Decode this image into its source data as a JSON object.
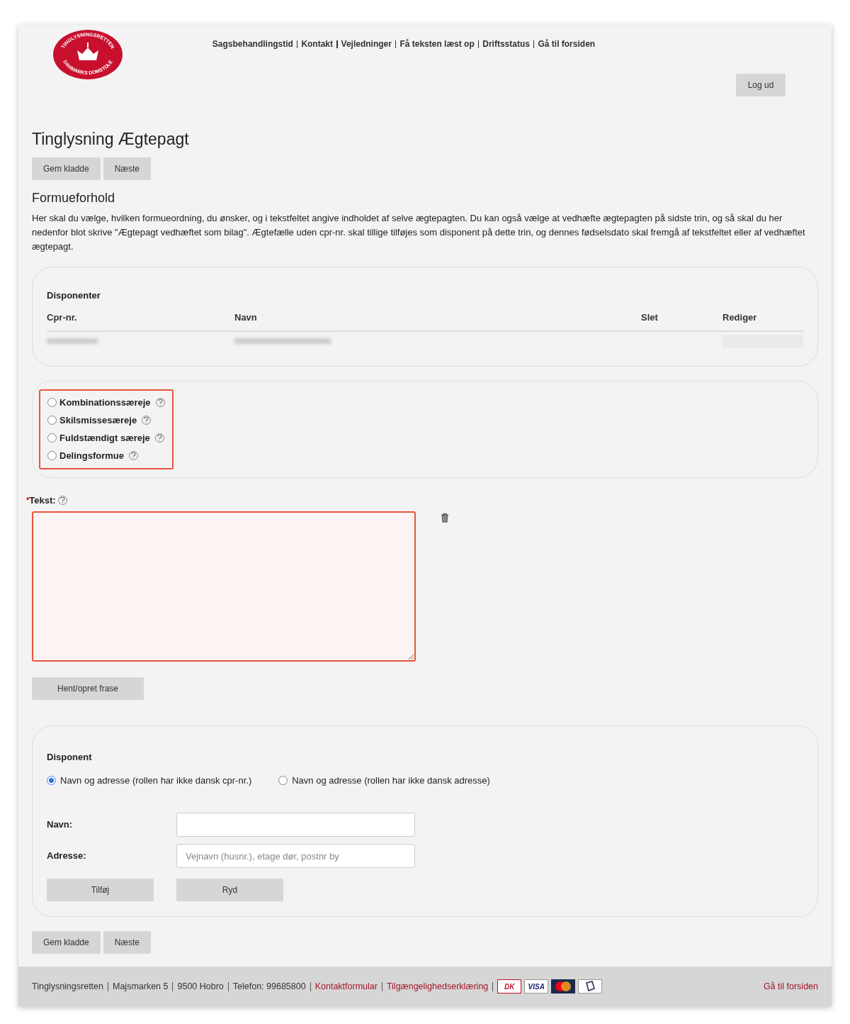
{
  "logo": {
    "top_text": "TINGLYSNINGSRETTEN",
    "bottom_text": "DANMARKS DOMSTOLE"
  },
  "top_links": [
    "Sagsbehandlingstid",
    "Kontakt",
    "Vejledninger",
    "Få teksten læst op",
    "Driftsstatus",
    "Gå til forsiden"
  ],
  "logout_button": "Log ud",
  "title": "Tinglysning Ægtepagt",
  "top_buttons": [
    "Gem kladde",
    "Næste"
  ],
  "section_title": "Formueforhold",
  "intro": "Her skal du vælge, hvilken formueordning, du ønsker, og i tekstfeltet angive indholdet af selve ægtepagten. Du kan også vælge at vedhæfte ægtepagten på sidste trin, og så skal du her nedenfor blot skrive \"Ægtepagt vedhæftet som bilag\". Ægtefælle uden cpr-nr. skal tillige tilføjes som disponent på dette trin, og dennes fødselsdato skal fremgå af tekstfeltet eller af vedhæftet ægtepagt.",
  "disponenter": {
    "title": "Disponenter",
    "columns": [
      "Cpr-nr.",
      "Navn",
      "Slet",
      "Rediger"
    ]
  },
  "regime_options": {
    "error": true,
    "items": [
      {
        "label": "Kombinationssæreje",
        "selected": false
      },
      {
        "label": "Skilsmissesæreje",
        "selected": false
      },
      {
        "label": "Fuldstændigt særeje",
        "selected": false
      },
      {
        "label": "Delingsformue",
        "selected": false
      }
    ]
  },
  "text_field": {
    "required_mark": "*",
    "label": "Tekst:",
    "error": true
  },
  "phrase_button": "Hent/opret frase",
  "disponent": {
    "title": "Disponent",
    "options": [
      {
        "label": "Navn og adresse (rollen har ikke dansk cpr-nr.)",
        "selected": true
      },
      {
        "label": "Navn og adresse (rollen har ikke dansk adresse)",
        "selected": false
      }
    ],
    "fields": [
      {
        "label": "Navn:"
      },
      {
        "label": "Adresse:",
        "placeholder": "Vejnavn (husnr.), etage dør, postnr by"
      }
    ],
    "buttons": [
      "Tilføj",
      "Ryd"
    ]
  },
  "bottom_buttons": [
    "Gem kladde",
    "Næste"
  ],
  "footer": {
    "items": [
      {
        "kind": "text",
        "text": "Tinglysningsretten"
      },
      {
        "kind": "text",
        "text": "Majsmarken 5"
      },
      {
        "kind": "text",
        "text": "9500 Hobro"
      },
      {
        "kind": "text",
        "text": "Telefon: 99685800"
      },
      {
        "kind": "link",
        "text": "Kontaktformular"
      },
      {
        "kind": "link",
        "text": "Tilgængelighedserklæring"
      }
    ],
    "cards": [
      "DK",
      "VISA"
    ],
    "home_link": "Gå til forsiden"
  }
}
